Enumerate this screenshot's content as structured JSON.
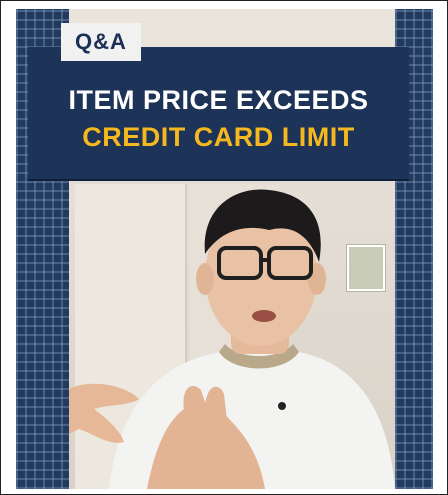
{
  "badge": {
    "text": "Q&A"
  },
  "headline": {
    "line1": "ITEM PRICE EXCEEDS",
    "line2": "CREDIT CARD LIMIT"
  },
  "colors": {
    "headline_bg": "#1d3358",
    "headline_line1": "#ffffff",
    "headline_line2": "#f5b81e",
    "badge_bg": "#f1f1f1",
    "badge_text": "#1c3056"
  }
}
